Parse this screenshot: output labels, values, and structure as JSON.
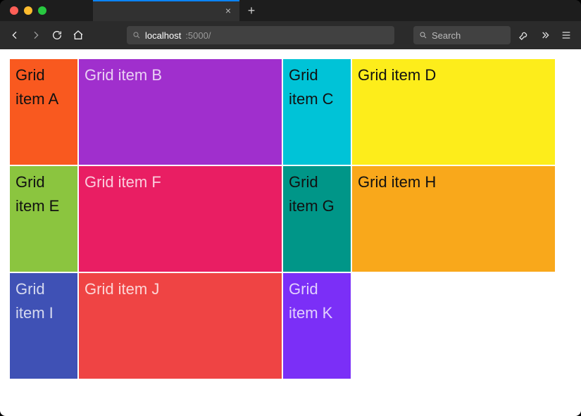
{
  "url": {
    "host": "localhost",
    "rest": ":5000/"
  },
  "search_placeholder": "Search",
  "grid": {
    "items": [
      {
        "label": "Grid item A",
        "bg": "#f9591f",
        "text": "dark"
      },
      {
        "label": "Grid item B",
        "bg": "#a02fcd",
        "text": "light"
      },
      {
        "label": "Grid item C",
        "bg": "#00c3d7",
        "text": "dark"
      },
      {
        "label": "Grid item D",
        "bg": "#fded1b",
        "text": "dark"
      },
      {
        "label": "Grid item E",
        "bg": "#8bc53f",
        "text": "dark"
      },
      {
        "label": "Grid item F",
        "bg": "#e91e63",
        "text": "light"
      },
      {
        "label": "Grid item G",
        "bg": "#009688",
        "text": "dark"
      },
      {
        "label": "Grid item H",
        "bg": "#f9a81b",
        "text": "dark"
      },
      {
        "label": "Grid item I",
        "bg": "#3f51b5",
        "text": "light"
      },
      {
        "label": "Grid item J",
        "bg": "#ef4444",
        "text": "light"
      },
      {
        "label": "Grid item K",
        "bg": "#7b2ff7",
        "text": "light"
      }
    ]
  }
}
